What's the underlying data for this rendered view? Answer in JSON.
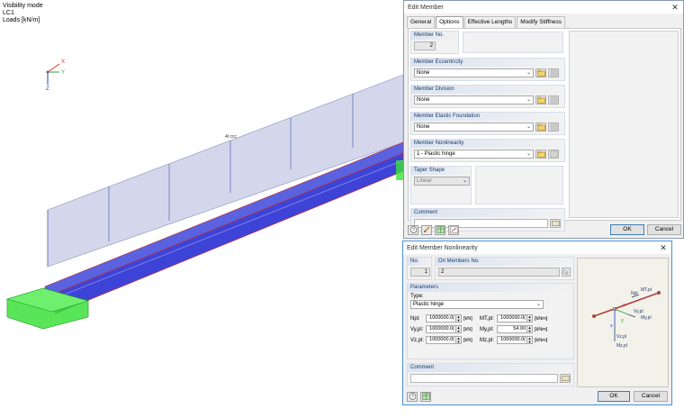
{
  "viewport": {
    "lines": [
      "Visibility mode",
      "LC1",
      "Loads [kN/m]"
    ],
    "axes": {
      "x": "X",
      "y": "Y",
      "z": "Z"
    },
    "load_label": "4t ccc"
  },
  "edit_member": {
    "title": "Edit Member",
    "tabs": [
      "General",
      "Options",
      "Effective Lengths",
      "Modify Stiffness"
    ],
    "active_tab": "Options",
    "member_no": {
      "label": "Member No.",
      "value": "2"
    },
    "eccentricity": {
      "label": "Member Eccentricity",
      "value": "None"
    },
    "division": {
      "label": "Member Division",
      "value": "None"
    },
    "foundation": {
      "label": "Member Elastic Foundation",
      "value": "None"
    },
    "nonlinearity": {
      "label": "Member Nonlinearity",
      "value": "1 - Plastic hinge"
    },
    "taper": {
      "label": "Taper Shape",
      "value": "Linear"
    },
    "comment": {
      "label": "Comment",
      "value": ""
    },
    "ok": "OK",
    "cancel": "Cancel"
  },
  "edit_nl": {
    "title": "Edit Member Nonlinearity",
    "no_label": "No.",
    "no_value": "1",
    "on_members_label": "On Members No.",
    "on_members_value": "2",
    "params_label": "Parameters",
    "type_label": "Type:",
    "type_value": "Plastic hinge",
    "params": [
      {
        "l1": "Npl:",
        "v1": "1000000.0(",
        "u1": "[kN]",
        "l2": "MT,pl:",
        "v2": "1000000.0(",
        "u2": "[kNm]"
      },
      {
        "l1": "Vy,pl:",
        "v1": "1000000.0(",
        "u1": "[kN]",
        "l2": "My,pl:",
        "v2": "54.00",
        "u2": "[kNm]"
      },
      {
        "l1": "Vz,pl:",
        "v1": "1000000.0(",
        "u1": "[kN]",
        "l2": "Mz,pl:",
        "v2": "1000000.0(",
        "u2": "[kNm]"
      }
    ],
    "comment_label": "Comment",
    "comment_value": "",
    "diagram_labels": {
      "x": "x",
      "y": "y",
      "z": "z",
      "npl": "Npl",
      "mtpl": "MT,pl",
      "vypl": "Vy,pl",
      "mypl": "My,pl",
      "vzpl": "Vz,pl",
      "mzpl": "Mz,pl"
    },
    "ok": "OK",
    "cancel": "Cancel"
  }
}
